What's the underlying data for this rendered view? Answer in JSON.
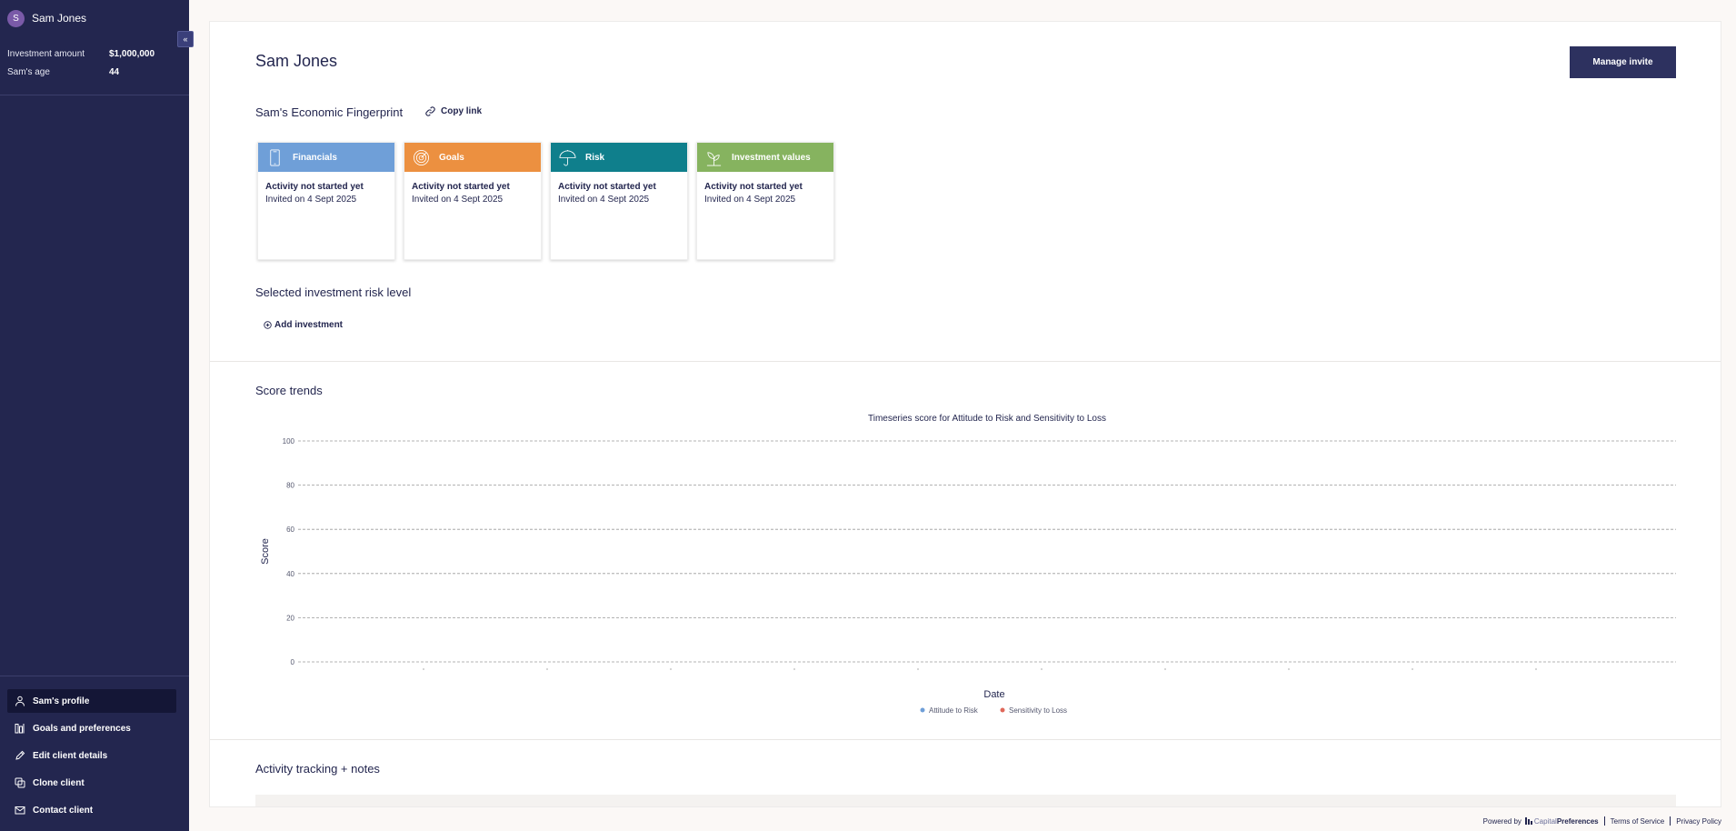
{
  "sidebar": {
    "avatar_initial": "S",
    "user_name": "Sam Jones",
    "collapse_icon": "chevron-left-icon",
    "info": [
      {
        "label": "Investment amount",
        "value": "$1,000,000"
      },
      {
        "label": "Sam's age",
        "value": "44"
      }
    ],
    "nav": [
      {
        "label": "Sam's profile",
        "icon": "person-icon",
        "active": true
      },
      {
        "label": "Goals and preferences",
        "icon": "bars-icon",
        "active": false
      },
      {
        "label": "Edit client details",
        "icon": "pencil-icon",
        "active": false
      },
      {
        "label": "Clone client",
        "icon": "copy-icon",
        "active": false
      },
      {
        "label": "Contact client",
        "icon": "mail-icon",
        "active": false
      }
    ]
  },
  "header": {
    "title": "Sam Jones",
    "manage_invite_label": "Manage invite"
  },
  "fingerprint": {
    "title": "Sam's Economic Fingerprint",
    "copy_link_label": "Copy link",
    "cards": [
      {
        "title": "Financials",
        "color": "#6f9fd8",
        "icon": "phone-icon",
        "status": "Activity not started yet",
        "invited": "Invited on 4 Sept 2025"
      },
      {
        "title": "Goals",
        "color": "#ec9040",
        "icon": "target-icon",
        "status": "Activity not started yet",
        "invited": "Invited on 4 Sept 2025"
      },
      {
        "title": "Risk",
        "color": "#0f7f8c",
        "icon": "umbrella-icon",
        "status": "Activity not started yet",
        "invited": "Invited on 4 Sept 2025"
      },
      {
        "title": "Investment values",
        "color": "#86b35f",
        "icon": "plant-icon",
        "status": "Activity not started yet",
        "invited": "Invited on 4 Sept 2025"
      }
    ]
  },
  "risk_level": {
    "title": "Selected investment risk level",
    "add_label": "Add investment"
  },
  "score_trends": {
    "title": "Score trends"
  },
  "chart_data": {
    "type": "line",
    "title": "Timeseries score for Attitude to Risk and Sensitivity to Loss",
    "xlabel": "Date",
    "ylabel": "Score",
    "ylim": [
      0,
      100
    ],
    "yticks": [
      "0",
      "20",
      "40",
      "60",
      "80",
      "100"
    ],
    "x_tick_count": 10,
    "grid": true,
    "legend_position": "bottom",
    "series": [
      {
        "name": "Attitude to Risk",
        "color": "#6f9fd8",
        "values": []
      },
      {
        "name": "Sensitivity to Loss",
        "color": "#e0685a",
        "values": []
      }
    ]
  },
  "activity": {
    "title": "Activity tracking + notes"
  },
  "footer": {
    "powered_by": "Powered by",
    "brand_light": "Capital",
    "brand_bold": "Preferences",
    "terms": "Terms of Service",
    "privacy": "Privacy Policy"
  }
}
